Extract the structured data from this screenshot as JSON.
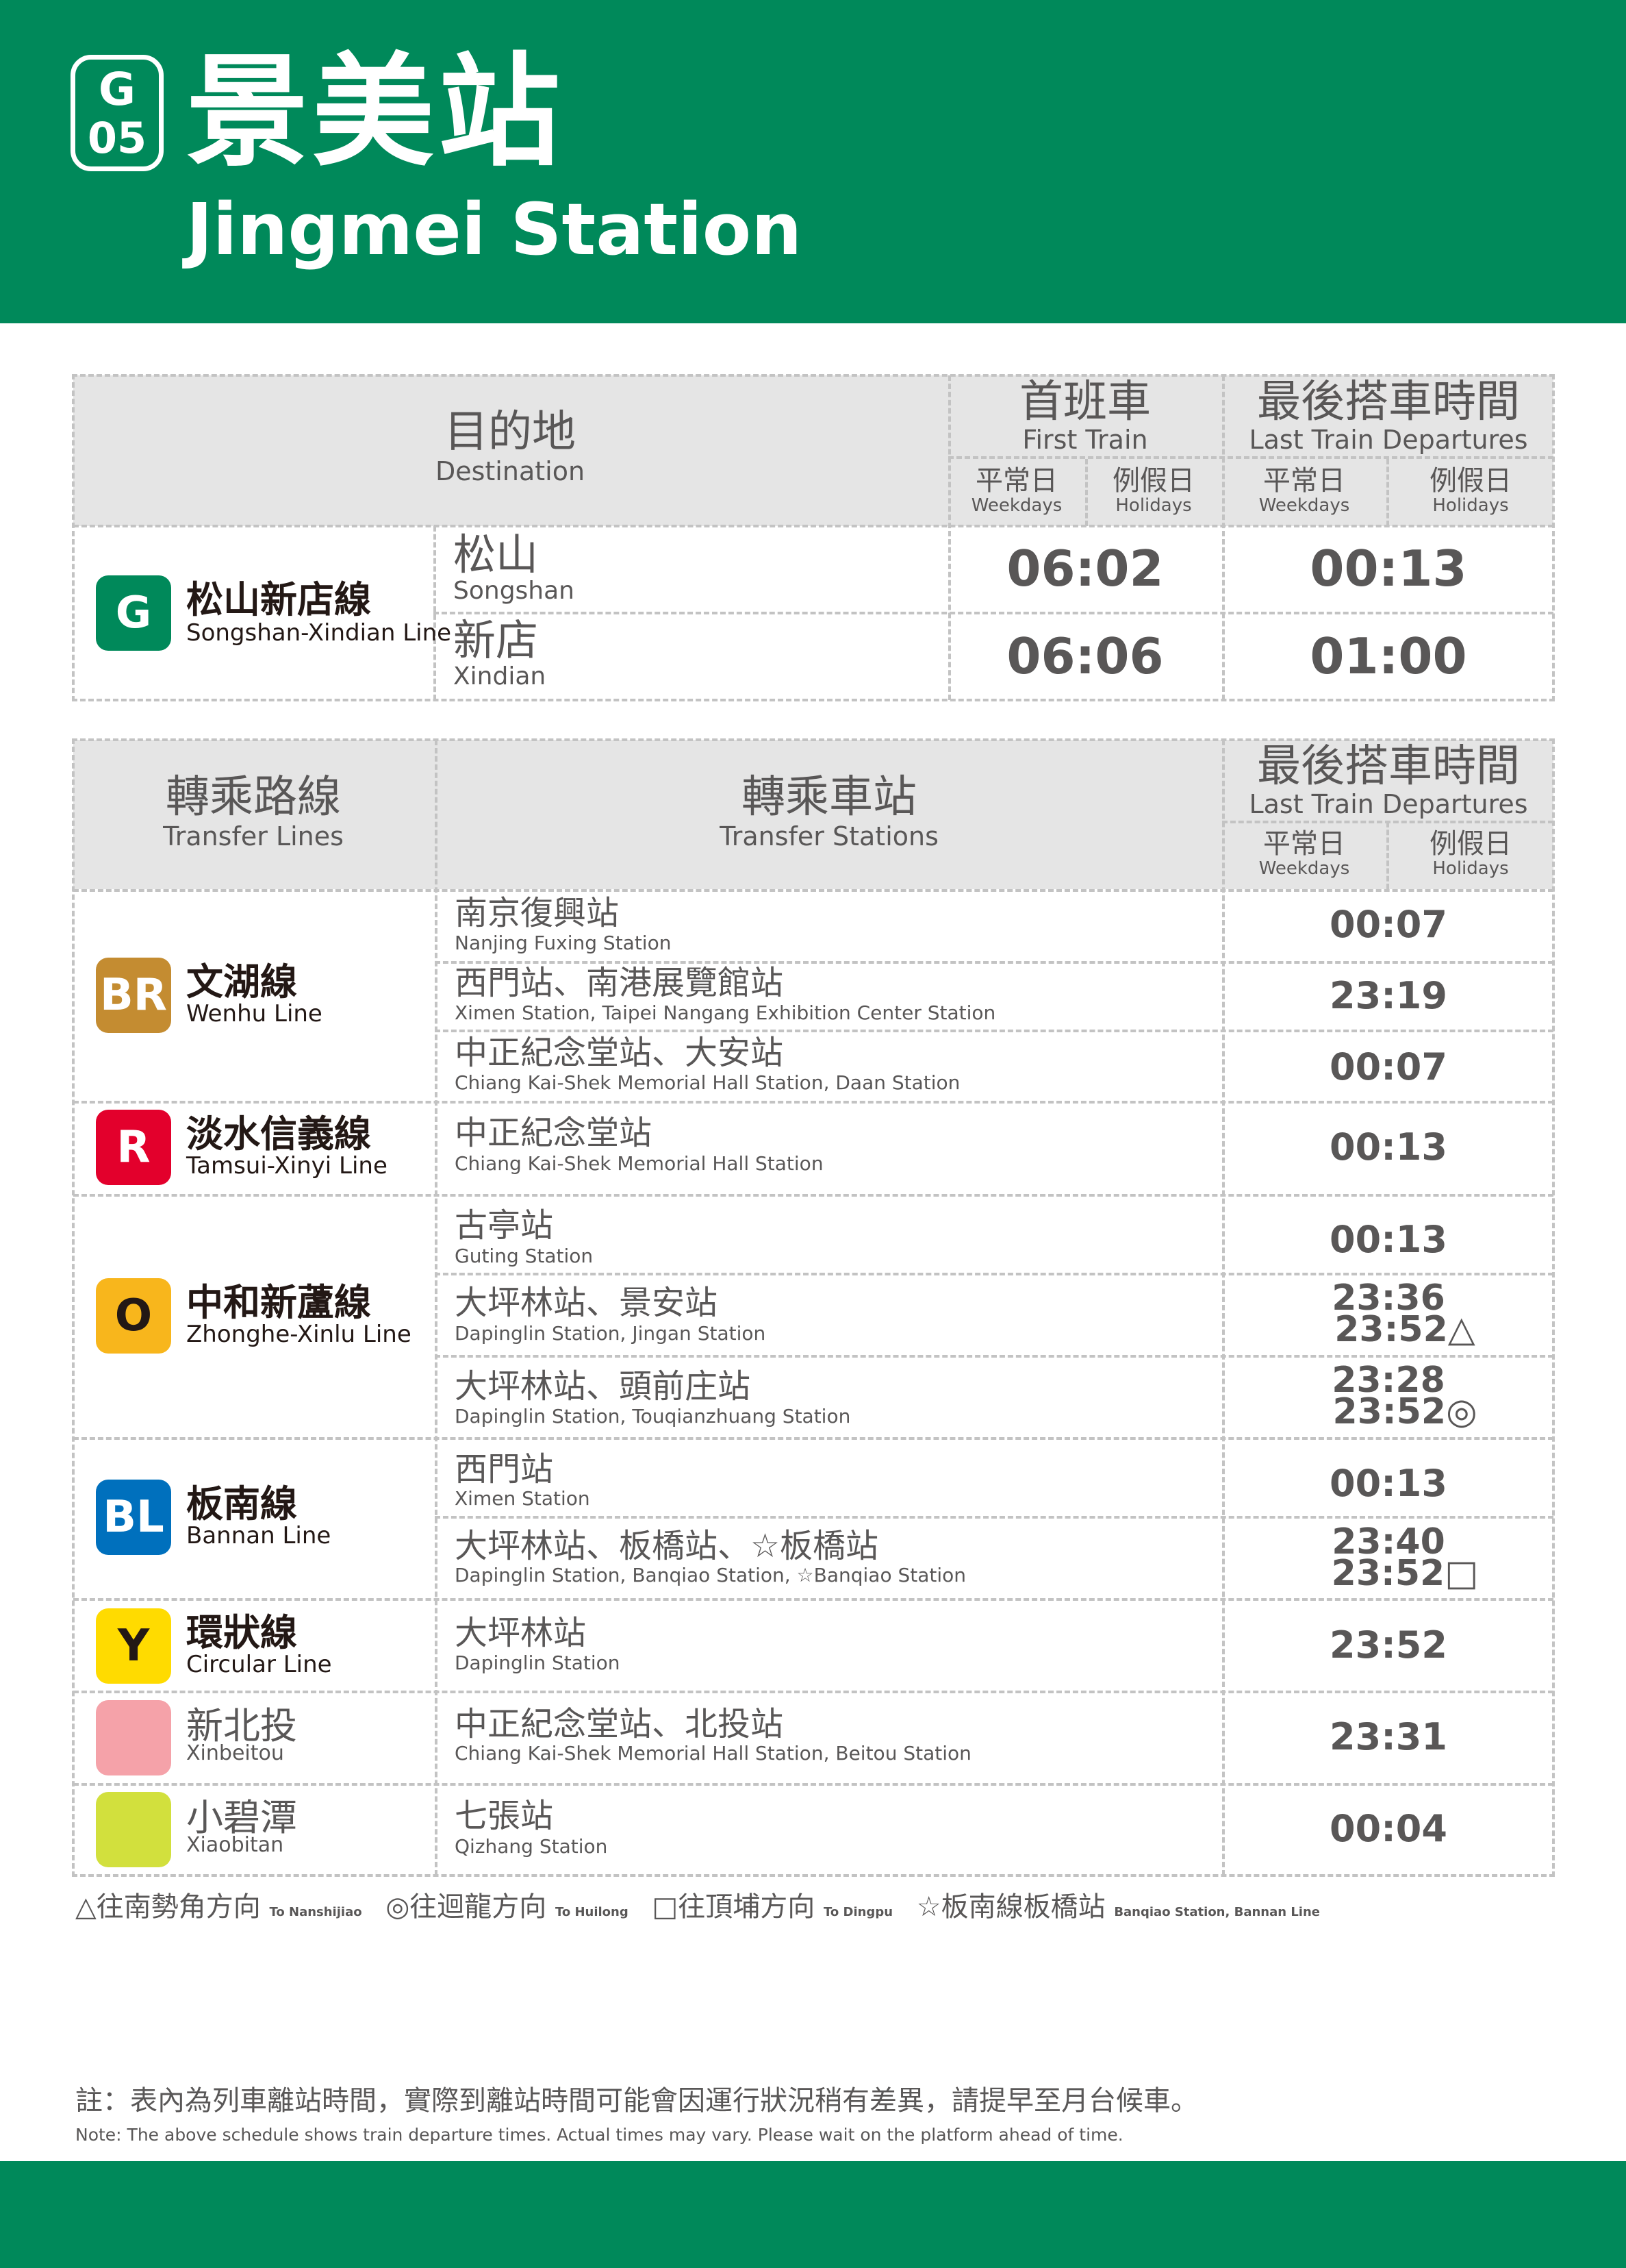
{
  "header": {
    "badge_line": "G",
    "badge_number": "05",
    "station_zh": "景美站",
    "station_en": "Jingmei Station"
  },
  "colors": {
    "header_green": "#00895a",
    "line_G": "#00895a",
    "line_BR": "#c48c31",
    "line_R": "#e3002c",
    "line_O": "#f8b61c",
    "line_BL": "#0070bd",
    "line_Y": "#ffdb00",
    "line_Xinbeitou": "#f5a2a9",
    "line_Xiaobitan": "#d2e03d"
  },
  "schedule": {
    "headers": {
      "destination_zh": "目的地",
      "destination_en": "Destination",
      "first_train_zh": "首班車",
      "first_train_en": "First Train",
      "last_train_zh": "最後搭車時間",
      "last_train_en": "Last Train Departures",
      "weekdays_zh": "平常日",
      "weekdays_en": "Weekdays",
      "holidays_zh": "例假日",
      "holidays_en": "Holidays"
    },
    "line": {
      "code": "G",
      "name_zh": "松山新店線",
      "name_en": "Songshan-Xindian Line"
    },
    "rows": [
      {
        "dest_zh": "松山",
        "dest_en": "Songshan",
        "first": "06:02",
        "last": "00:13"
      },
      {
        "dest_zh": "新店",
        "dest_en": "Xindian",
        "first": "06:06",
        "last": "01:00"
      }
    ]
  },
  "transfer": {
    "headers": {
      "lines_zh": "轉乘路線",
      "lines_en": "Transfer Lines",
      "stations_zh": "轉乘車站",
      "stations_en": "Transfer Stations",
      "last_train_zh": "最後搭車時間",
      "last_train_en": "Last Train Departures",
      "weekdays_zh": "平常日",
      "weekdays_en": "Weekdays",
      "holidays_zh": "例假日",
      "holidays_en": "Holidays"
    },
    "lines": [
      {
        "code": "BR",
        "name_zh": "文湖線",
        "name_en": "Wenhu Line"
      },
      {
        "code": "R",
        "name_zh": "淡水信義線",
        "name_en": "Tamsui-Xinyi Line"
      },
      {
        "code": "O",
        "name_zh": "中和新蘆線",
        "name_en": "Zhonghe-Xinlu Line"
      },
      {
        "code": "BL",
        "name_zh": "板南線",
        "name_en": "Bannan Line"
      },
      {
        "code": "Y",
        "name_zh": "環狀線",
        "name_en": "Circular Line"
      },
      {
        "code": "",
        "name_zh": "新北投",
        "name_en": "Xinbeitou"
      },
      {
        "code": "",
        "name_zh": "小碧潭",
        "name_en": "Xiaobitan"
      }
    ],
    "rows": [
      {
        "st_zh": "南京復興站",
        "st_en": "Nanjing Fuxing Station",
        "time1": "00:07"
      },
      {
        "st_zh": "西門站、南港展覽館站",
        "st_en": "Ximen Station, Taipei Nangang Exhibition Center Station",
        "time1": "23:19"
      },
      {
        "st_zh": "中正紀念堂站、大安站",
        "st_en": "Chiang Kai-Shek Memorial Hall Station, Daan Station",
        "time1": "00:07"
      },
      {
        "st_zh": "中正紀念堂站",
        "st_en": "Chiang Kai-Shek Memorial Hall Station",
        "time1": "00:13"
      },
      {
        "st_zh": "古亭站",
        "st_en": "Guting Station",
        "time1": "00:13"
      },
      {
        "st_zh": "大坪林站、景安站",
        "st_en": "Dapinglin Station, Jingan Station",
        "time1": "23:36",
        "time2": "23:52△"
      },
      {
        "st_zh": "大坪林站、頭前庄站",
        "st_en": "Dapinglin Station, Touqianzhuang Station",
        "time1": "23:28",
        "time2": "23:52◎"
      },
      {
        "st_zh": "西門站",
        "st_en": "Ximen Station",
        "time1": "00:13"
      },
      {
        "st_zh": "大坪林站、板橋站、☆板橋站",
        "st_en": "Dapinglin Station, Banqiao Station, ☆Banqiao Station",
        "time1": "23:40",
        "time2": "23:52□"
      },
      {
        "st_zh": "大坪林站",
        "st_en": "Dapinglin Station",
        "time1": "23:52"
      },
      {
        "st_zh": "中正紀念堂站、北投站",
        "st_en": "Chiang Kai-Shek Memorial Hall Station, Beitou Station",
        "time1": "23:31"
      },
      {
        "st_zh": "七張站",
        "st_en": "Qizhang Station",
        "time1": "00:04"
      }
    ]
  },
  "legend": [
    {
      "zh": "△往南勢角方向",
      "en": "To Nanshijiao"
    },
    {
      "zh": "◎往迴龍方向",
      "en": "To Huilong"
    },
    {
      "zh": "□往頂埔方向",
      "en": "To Dingpu"
    },
    {
      "zh": "☆板南線板橋站",
      "en": "Banqiao Station, Bannan Line"
    }
  ],
  "note": {
    "zh": "註：表內為列車離站時間，實際到離站時間可能會因運行狀況稍有差異，請提早至月台候車。",
    "en": "Note: The above schedule shows train departure times. Actual times may vary. Please wait on the platform ahead of time."
  }
}
